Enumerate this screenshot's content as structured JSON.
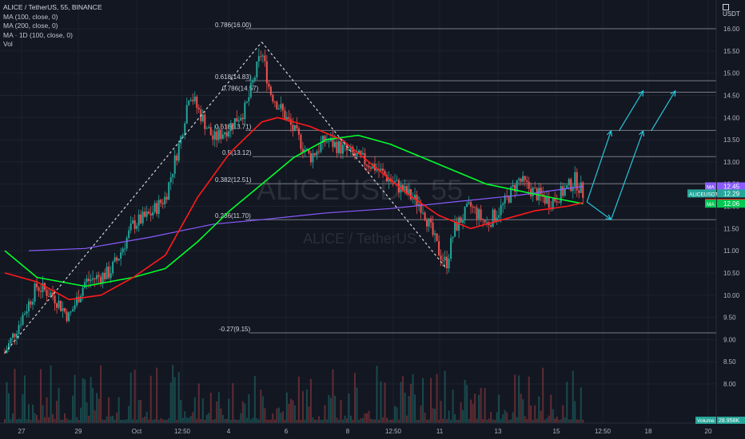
{
  "legend": {
    "title": "ALICE / TetherUS, 55, BINANCE",
    "ma1": "MA (100, close, 0)",
    "ma2": "MA (200, close, 0)",
    "ma3": "MA · 1D (100, close, 0)",
    "vol": "Vol"
  },
  "currency_label": "USDT",
  "watermark": {
    "symbol": "ALICEUSDT, 55",
    "name": "ALICE / TetherUS"
  },
  "colors": {
    "background": "#131722",
    "grid": "#1e222d",
    "text": "#b2b5be",
    "up_candle": "#26a69a",
    "down_candle": "#ef5350",
    "ma_green": "#00ff2a",
    "ma_red": "#ff1a1a",
    "ma_purple": "#8a5cff",
    "fib": "#787b86",
    "projection": "#26c6da",
    "triangle": "#d1d4dc"
  },
  "chart_data": {
    "type": "candlestick",
    "y_axis_ticks": [
      "16.00",
      "15.50",
      "15.00",
      "14.50",
      "14.00",
      "13.50",
      "13.00",
      "12.50",
      "12.00",
      "11.50",
      "11.00",
      "10.50",
      "10.00",
      "9.50",
      "9.00",
      "8.50",
      "8.00"
    ],
    "ylim": [
      7.5,
      16.3
    ],
    "x_axis_ticks": [
      "27",
      "29",
      "Oct",
      "12:50",
      "4",
      "6",
      "8",
      "12:50",
      "11",
      "13",
      "15",
      "12:50",
      "18",
      "20"
    ],
    "fib_levels": [
      {
        "label": "0.786(16.00)",
        "value": 16.0
      },
      {
        "label": "0.618(14.83)",
        "value": 14.83
      },
      {
        "label": "0.786(14.57)",
        "value": 14.57
      },
      {
        "label": "0.618(13.71)",
        "value": 13.71
      },
      {
        "label": "0.5(13.12)",
        "value": 13.12
      },
      {
        "label": "0.382(12.51)",
        "value": 12.51
      },
      {
        "label": "0.236(11.70)",
        "value": 11.7
      },
      {
        "label": "-0.27(9.15)",
        "value": 9.15
      }
    ],
    "price_badges": [
      {
        "label": "MA",
        "value": "12.45",
        "color": "#8a5cff"
      },
      {
        "label": "ALICEUSDT",
        "value": "12.29",
        "color": "#26a69a"
      },
      {
        "label": "MA",
        "value": "12.08",
        "color": "#ff1a1a"
      },
      {
        "label": "MA",
        "value": "12.06",
        "color": "#00c853"
      }
    ],
    "volume_label": "Volume",
    "volume_value": "28.958K",
    "price_path": [
      {
        "x": 0,
        "y": 8.7
      },
      {
        "x": 4,
        "y": 10.2
      },
      {
        "x": 6,
        "y": 10.0
      },
      {
        "x": 8,
        "y": 9.5
      },
      {
        "x": 10,
        "y": 10.3
      },
      {
        "x": 13,
        "y": 10.5
      },
      {
        "x": 14,
        "y": 10.8
      },
      {
        "x": 16,
        "y": 11.6
      },
      {
        "x": 18,
        "y": 11.8
      },
      {
        "x": 20,
        "y": 12.2
      },
      {
        "x": 22,
        "y": 13.6
      },
      {
        "x": 23,
        "y": 14.6
      },
      {
        "x": 24,
        "y": 14.2
      },
      {
        "x": 26,
        "y": 13.5
      },
      {
        "x": 28,
        "y": 13.8
      },
      {
        "x": 30,
        "y": 14.2
      },
      {
        "x": 32,
        "y": 15.5
      },
      {
        "x": 33,
        "y": 14.6
      },
      {
        "x": 34,
        "y": 14.3
      },
      {
        "x": 36,
        "y": 13.7
      },
      {
        "x": 38,
        "y": 13.1
      },
      {
        "x": 40,
        "y": 13.5
      },
      {
        "x": 42,
        "y": 13.3
      },
      {
        "x": 44,
        "y": 13.1
      },
      {
        "x": 46,
        "y": 12.9
      },
      {
        "x": 48,
        "y": 12.6
      },
      {
        "x": 50,
        "y": 12.3
      },
      {
        "x": 52,
        "y": 12.0
      },
      {
        "x": 53,
        "y": 11.5
      },
      {
        "x": 54,
        "y": 11.0
      },
      {
        "x": 55,
        "y": 10.7
      },
      {
        "x": 56,
        "y": 11.5
      },
      {
        "x": 58,
        "y": 12.0
      },
      {
        "x": 60,
        "y": 11.6
      },
      {
        "x": 62,
        "y": 12.0
      },
      {
        "x": 64,
        "y": 12.6
      },
      {
        "x": 66,
        "y": 12.3
      },
      {
        "x": 68,
        "y": 12.1
      },
      {
        "x": 70,
        "y": 12.4
      },
      {
        "x": 71,
        "y": 12.6
      },
      {
        "x": 72,
        "y": 12.3
      }
    ],
    "ma_green": [
      {
        "x": 0,
        "y": 11.0
      },
      {
        "x": 4,
        "y": 10.4
      },
      {
        "x": 10,
        "y": 10.2
      },
      {
        "x": 16,
        "y": 10.4
      },
      {
        "x": 20,
        "y": 10.6
      },
      {
        "x": 24,
        "y": 11.2
      },
      {
        "x": 28,
        "y": 11.9
      },
      {
        "x": 32,
        "y": 12.5
      },
      {
        "x": 36,
        "y": 13.1
      },
      {
        "x": 40,
        "y": 13.5
      },
      {
        "x": 44,
        "y": 13.6
      },
      {
        "x": 48,
        "y": 13.4
      },
      {
        "x": 52,
        "y": 13.1
      },
      {
        "x": 56,
        "y": 12.8
      },
      {
        "x": 60,
        "y": 12.5
      },
      {
        "x": 64,
        "y": 12.35
      },
      {
        "x": 68,
        "y": 12.2
      },
      {
        "x": 72,
        "y": 12.06
      }
    ],
    "ma_red": [
      {
        "x": 0,
        "y": 10.5
      },
      {
        "x": 4,
        "y": 10.3
      },
      {
        "x": 8,
        "y": 9.9
      },
      {
        "x": 12,
        "y": 10.0
      },
      {
        "x": 16,
        "y": 10.4
      },
      {
        "x": 20,
        "y": 10.9
      },
      {
        "x": 24,
        "y": 12.2
      },
      {
        "x": 28,
        "y": 13.2
      },
      {
        "x": 32,
        "y": 13.9
      },
      {
        "x": 34,
        "y": 14.0
      },
      {
        "x": 38,
        "y": 13.8
      },
      {
        "x": 42,
        "y": 13.5
      },
      {
        "x": 46,
        "y": 12.9
      },
      {
        "x": 50,
        "y": 12.3
      },
      {
        "x": 54,
        "y": 11.8
      },
      {
        "x": 58,
        "y": 11.5
      },
      {
        "x": 62,
        "y": 11.7
      },
      {
        "x": 66,
        "y": 11.9
      },
      {
        "x": 70,
        "y": 12.0
      },
      {
        "x": 72,
        "y": 12.08
      }
    ],
    "ma_purple": [
      {
        "x": 3,
        "y": 11.0
      },
      {
        "x": 10,
        "y": 11.05
      },
      {
        "x": 18,
        "y": 11.3
      },
      {
        "x": 26,
        "y": 11.6
      },
      {
        "x": 32,
        "y": 11.7
      },
      {
        "x": 40,
        "y": 11.85
      },
      {
        "x": 48,
        "y": 11.95
      },
      {
        "x": 56,
        "y": 12.1
      },
      {
        "x": 64,
        "y": 12.25
      },
      {
        "x": 72,
        "y": 12.45
      }
    ],
    "triangle": [
      {
        "x": 0,
        "y": 8.7
      },
      {
        "x": 32,
        "y": 15.7
      },
      {
        "x": 55,
        "y": 10.6
      }
    ],
    "projections": [
      {
        "from": {
          "x": 72.5,
          "y": 12.1
        },
        "to": {
          "x": 75.5,
          "y": 13.7
        }
      },
      {
        "from": {
          "x": 75.5,
          "y": 11.7
        },
        "to": {
          "x": 79.5,
          "y": 13.7
        }
      },
      {
        "from": {
          "x": 76.5,
          "y": 13.7
        },
        "to": {
          "x": 79.5,
          "y": 14.6
        }
      },
      {
        "from": {
          "x": 80.5,
          "y": 13.7
        },
        "to": {
          "x": 83.5,
          "y": 14.6
        }
      },
      {
        "from": {
          "x": 72.5,
          "y": 12.1
        },
        "to": {
          "x": 75.5,
          "y": 11.7
        }
      }
    ],
    "x_range": [
      0,
      88
    ]
  }
}
